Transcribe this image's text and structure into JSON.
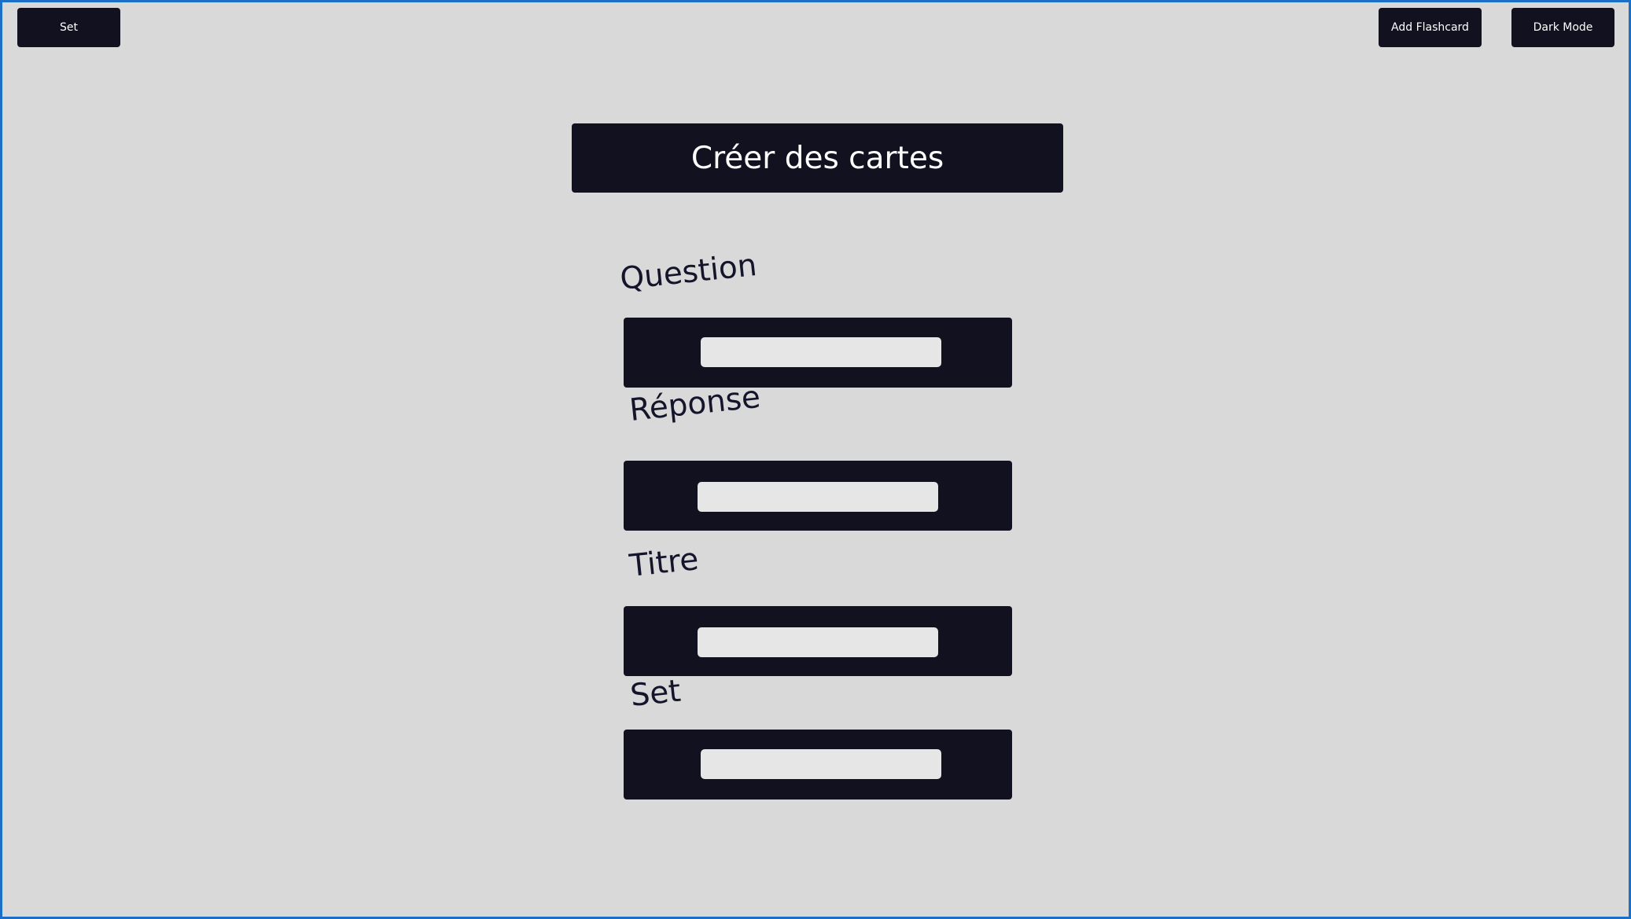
{
  "toolbar": {
    "set_label": "Set",
    "add_flashcard_label": "Add Flashcard",
    "dark_mode_label": "Dark Mode"
  },
  "page": {
    "title": "Créer des cartes"
  },
  "form": {
    "fields": [
      {
        "label": "Question",
        "value": "",
        "placeholder": ""
      },
      {
        "label": "Réponse",
        "value": "",
        "placeholder": ""
      },
      {
        "label": "Titre",
        "value": "",
        "placeholder": ""
      },
      {
        "label": "Set",
        "value": "",
        "placeholder": ""
      }
    ]
  },
  "colors": {
    "background": "#d9d9d9",
    "panel": "#11111f",
    "input": "#e6e6e6",
    "frame_border": "#1b6fc6",
    "label_text": "#14142b",
    "button_text": "#ffffff"
  }
}
